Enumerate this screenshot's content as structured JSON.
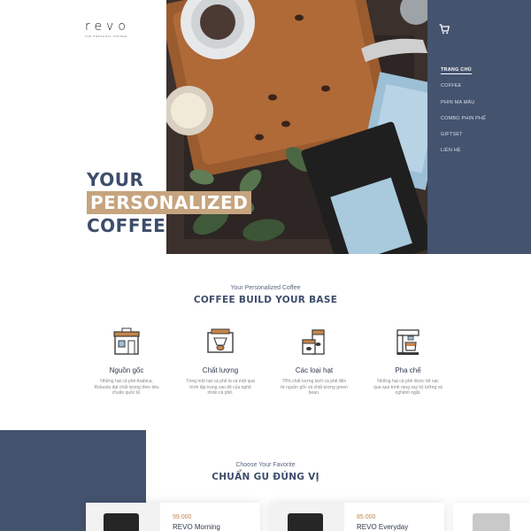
{
  "brand": {
    "logo_text": "revo",
    "logo_tagline": "THE PERSONAL COFFEE"
  },
  "hero": {
    "lines": [
      "YOUR",
      "PERSONALIZED",
      "COFFEE"
    ]
  },
  "nav": {
    "items": [
      {
        "label": "TRANG CHỦ",
        "active": true
      },
      {
        "label": "COFFEE",
        "active": false
      },
      {
        "label": "PHIN MA MÂU",
        "active": false
      },
      {
        "label": "COMBO PHIN PHẾ",
        "active": false
      },
      {
        "label": "GIFTSET",
        "active": false
      },
      {
        "label": "LIÊN HỆ",
        "active": false
      }
    ]
  },
  "section_base": {
    "subtitle": "Your Personalized Coffee",
    "title": "COFFEE BUILD YOUR BASE",
    "features": [
      {
        "icon": "shop-icon",
        "name": "Nguồn gốc",
        "desc": "Những hạt cà phê Arabica, Robusta đạt chất lượng theo tiêu chuẩn quốc tế."
      },
      {
        "icon": "roaster-icon",
        "name": "Chất lượng",
        "desc": "Từng một hạt cà phê là cả một quá trình tập trung cao độ của nghệ nhân cà phê."
      },
      {
        "icon": "coffee-bag-icon",
        "name": "Các loại hạt",
        "desc": "70% chất lượng tách cà phê đến từ nguồn gốc và chất lượng green bean."
      },
      {
        "icon": "coffee-machine-icon",
        "name": "Pha chế",
        "desc": "Những hạt cà phê được tốt xác qua quá trình rang xay kỹ lưỡng và nghiêm ngặt."
      }
    ]
  },
  "section_products": {
    "subtitle": "Choose Your Favorite",
    "title": "CHUẨN GU ĐÚNG VỊ",
    "products": [
      {
        "price": "99.000",
        "name": "REVO Morning"
      },
      {
        "price": "85.000",
        "name": "REVO Everyday"
      }
    ]
  },
  "colors": {
    "navy": "#44536e",
    "title": "#3d4d6b",
    "tan": "#c6a47e",
    "price": "#c6874a"
  }
}
